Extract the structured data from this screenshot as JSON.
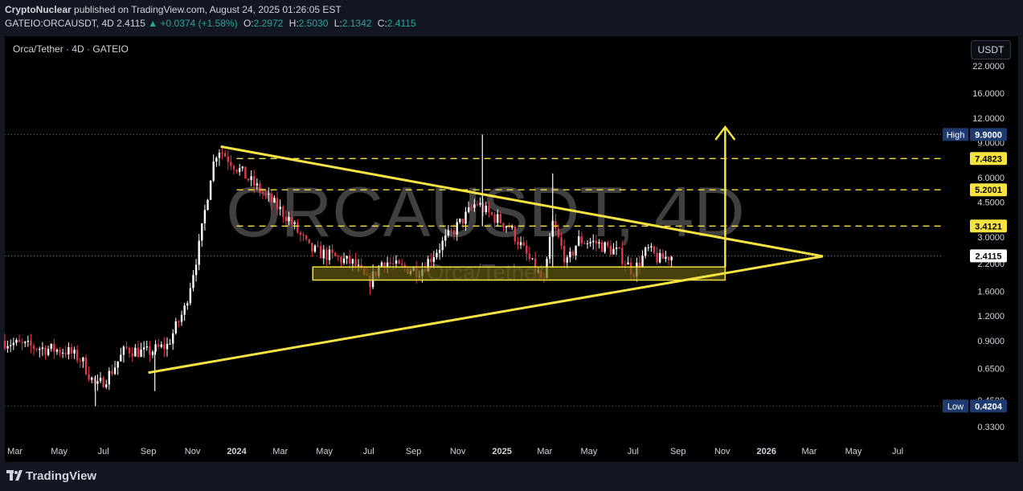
{
  "header": {
    "author": "CryptoNuclear",
    "published": "published on TradingView.com, August 24, 2025 01:26:05 EST",
    "symbol": "GATEIO:ORCAUSDT, 4D",
    "last": "2.4115",
    "change": "+0.0374 (+1.58%)",
    "open_label": "O:",
    "open": "2.2972",
    "high_label": "H:",
    "high": "2.5030",
    "low_label": "L:",
    "low": "2.1342",
    "close_label": "C:",
    "close": "2.4115"
  },
  "chart_title": "Orca/Tether · 4D · GATEIO",
  "currency_button": "USDT",
  "footer": {
    "brand": "TradingView"
  },
  "colors": {
    "up": "#ffffff",
    "down": "#e0394a",
    "pattern": "#f5e342",
    "zone": "#6b6410",
    "price_tag": "#ffffff",
    "high_low_tag": "#1e3a6e"
  },
  "chart_data": {
    "type": "candlestick",
    "watermark": "ORCAUSDT, 4D",
    "watermark_sub": "Orca/Tether",
    "scale": "log",
    "ylim": [
      0.29,
      27
    ],
    "xlim": [
      "2023-02-15",
      "2026-08-31"
    ],
    "y_ticks": [
      "22.0000",
      "16.0000",
      "12.0000",
      "9.0000",
      "6.0000",
      "4.5000",
      "3.0000",
      "2.2000",
      "1.6000",
      "1.2000",
      "0.9000",
      "0.6500",
      "0.4500",
      "0.3300"
    ],
    "x_ticks": [
      "Mar",
      "May",
      "Jul",
      "Sep",
      "Nov",
      "2024",
      "Mar",
      "May",
      "Jul",
      "Sep",
      "Nov",
      "2025",
      "Mar",
      "May",
      "Jul",
      "Sep",
      "Nov",
      "2026",
      "Mar",
      "May",
      "Jul"
    ],
    "high": {
      "label": "High",
      "value": "9.9000"
    },
    "low": {
      "label": "Low",
      "value": "0.4204"
    },
    "resistance_levels": [
      "7.4823",
      "5.2001",
      "3.4121"
    ],
    "current_price": "2.4115",
    "price_series": [
      [
        "2023-02-15",
        0.9
      ],
      [
        "2023-03-15",
        0.85
      ],
      [
        "2023-04-15",
        0.82
      ],
      [
        "2023-05-15",
        0.8
      ],
      [
        "2023-06-05",
        0.72
      ],
      [
        "2023-06-25",
        0.52
      ],
      [
        "2023-07-15",
        0.62
      ],
      [
        "2023-08-05",
        0.82
      ],
      [
        "2023-09-01",
        0.78
      ],
      [
        "2023-10-01",
        0.85
      ],
      [
        "2023-10-25",
        1.3
      ],
      [
        "2023-11-15",
        2.8
      ],
      [
        "2023-12-01",
        6.5
      ],
      [
        "2023-12-10",
        8.5
      ],
      [
        "2024-01-15",
        6.2
      ],
      [
        "2024-02-15",
        4.8
      ],
      [
        "2024-03-15",
        3.8
      ],
      [
        "2024-04-15",
        2.6
      ],
      [
        "2024-05-15",
        2.4
      ],
      [
        "2024-06-15",
        2.2
      ],
      [
        "2024-07-05",
        1.75
      ],
      [
        "2024-07-25",
        2.3
      ],
      [
        "2024-08-15",
        2.1
      ],
      [
        "2024-09-15",
        2.05
      ],
      [
        "2024-10-15",
        2.8
      ],
      [
        "2024-11-10",
        3.6
      ],
      [
        "2024-12-01",
        4.5
      ],
      [
        "2024-12-15",
        4.0
      ],
      [
        "2025-01-15",
        3.4
      ],
      [
        "2025-02-15",
        2.2
      ],
      [
        "2025-03-05",
        1.75
      ],
      [
        "2025-03-15",
        3.6
      ],
      [
        "2025-04-05",
        2.2
      ],
      [
        "2025-04-20",
        2.9
      ],
      [
        "2025-05-15",
        2.8
      ],
      [
        "2025-06-15",
        2.5
      ],
      [
        "2025-07-05",
        2.0
      ],
      [
        "2025-07-25",
        2.6
      ],
      [
        "2025-08-10",
        2.3
      ],
      [
        "2025-08-24",
        2.41
      ]
    ],
    "pattern": {
      "upper_trendline": [
        [
          "2023-12-10",
          8.6
        ],
        [
          "2026-03-20",
          2.4
        ]
      ],
      "lower_trendline": [
        [
          "2023-09-01",
          0.62
        ],
        [
          "2026-03-20",
          2.4
        ]
      ],
      "support_zone": {
        "from": "2024-04-15",
        "to": "2025-11-05",
        "low": 1.82,
        "high": 2.12
      },
      "target_arrow": {
        "x": "2025-11-05",
        "from": 2.12,
        "to": 10.8
      }
    }
  }
}
